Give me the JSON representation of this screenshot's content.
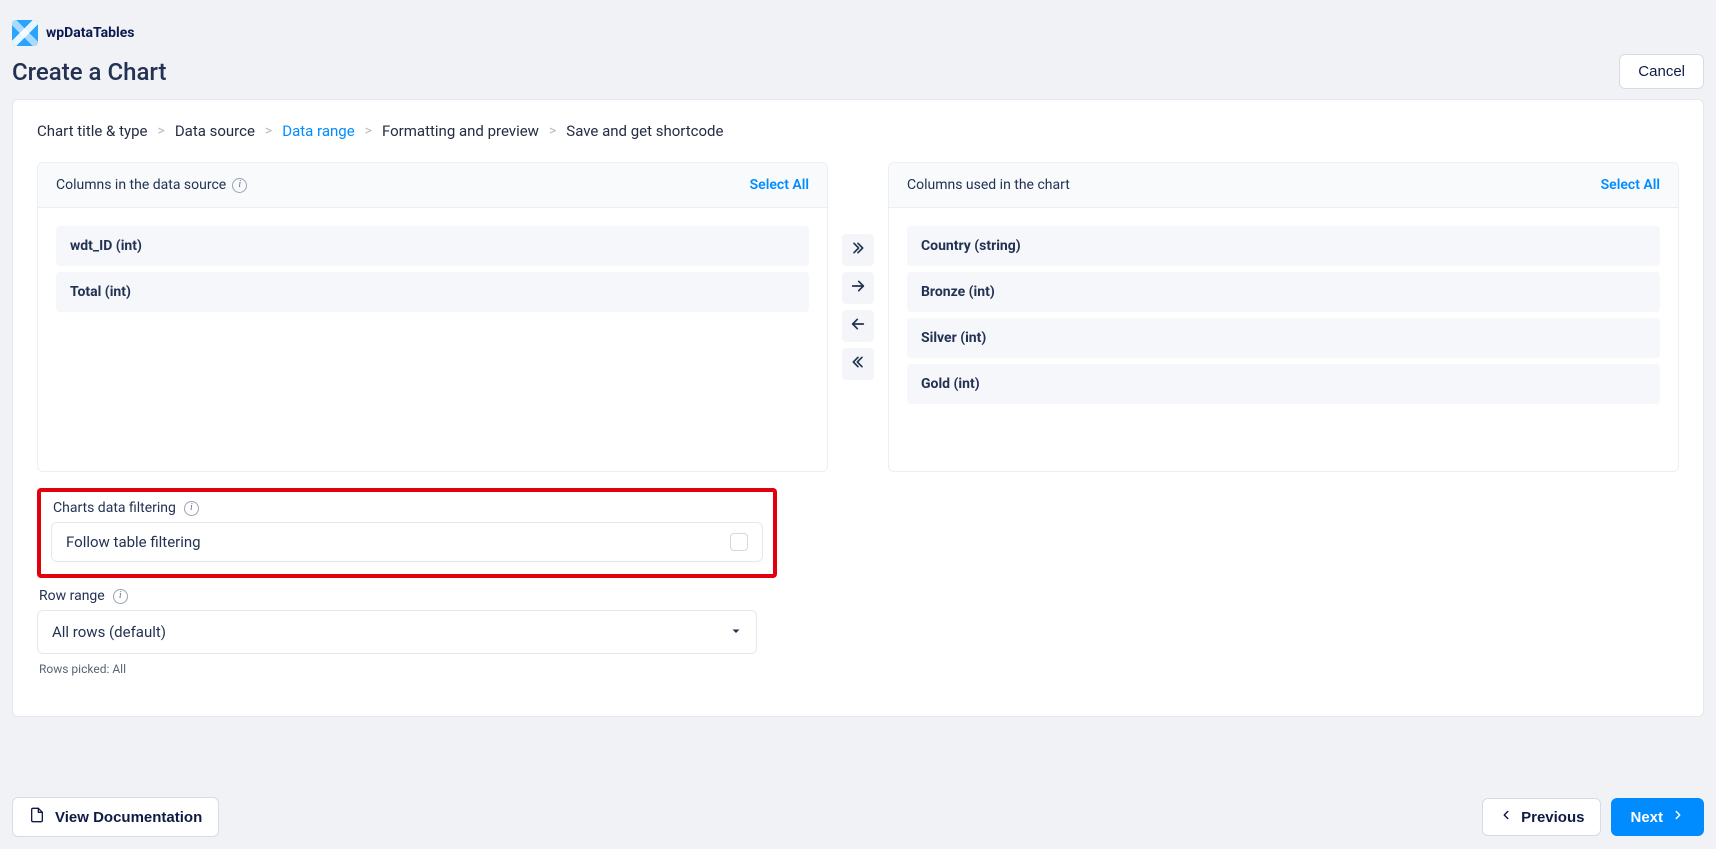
{
  "brand": {
    "name": "wpDataTables"
  },
  "header": {
    "title": "Create a Chart",
    "cancel": "Cancel"
  },
  "breadcrumb": {
    "items": [
      {
        "label": "Chart title & type",
        "active": false
      },
      {
        "label": "Data source",
        "active": false
      },
      {
        "label": "Data range",
        "active": true
      },
      {
        "label": "Formatting and preview",
        "active": false
      },
      {
        "label": "Save and get shortcode",
        "active": false
      }
    ]
  },
  "source_box": {
    "title": "Columns in the data source",
    "select_all": "Select All",
    "items": [
      {
        "label": "wdt_ID (int)"
      },
      {
        "label": "Total (int)"
      }
    ]
  },
  "used_box": {
    "title": "Columns used in the chart",
    "select_all": "Select All",
    "items": [
      {
        "label": "Country (string)"
      },
      {
        "label": "Bronze (int)"
      },
      {
        "label": "Silver (int)"
      },
      {
        "label": "Gold (int)"
      }
    ]
  },
  "filtering": {
    "title": "Charts data filtering",
    "follow_label": "Follow table filtering"
  },
  "row_range": {
    "title": "Row range",
    "selected": "All rows (default)",
    "picked": "Rows picked: All"
  },
  "footer": {
    "doc": "View Documentation",
    "prev": "Previous",
    "next": "Next"
  }
}
